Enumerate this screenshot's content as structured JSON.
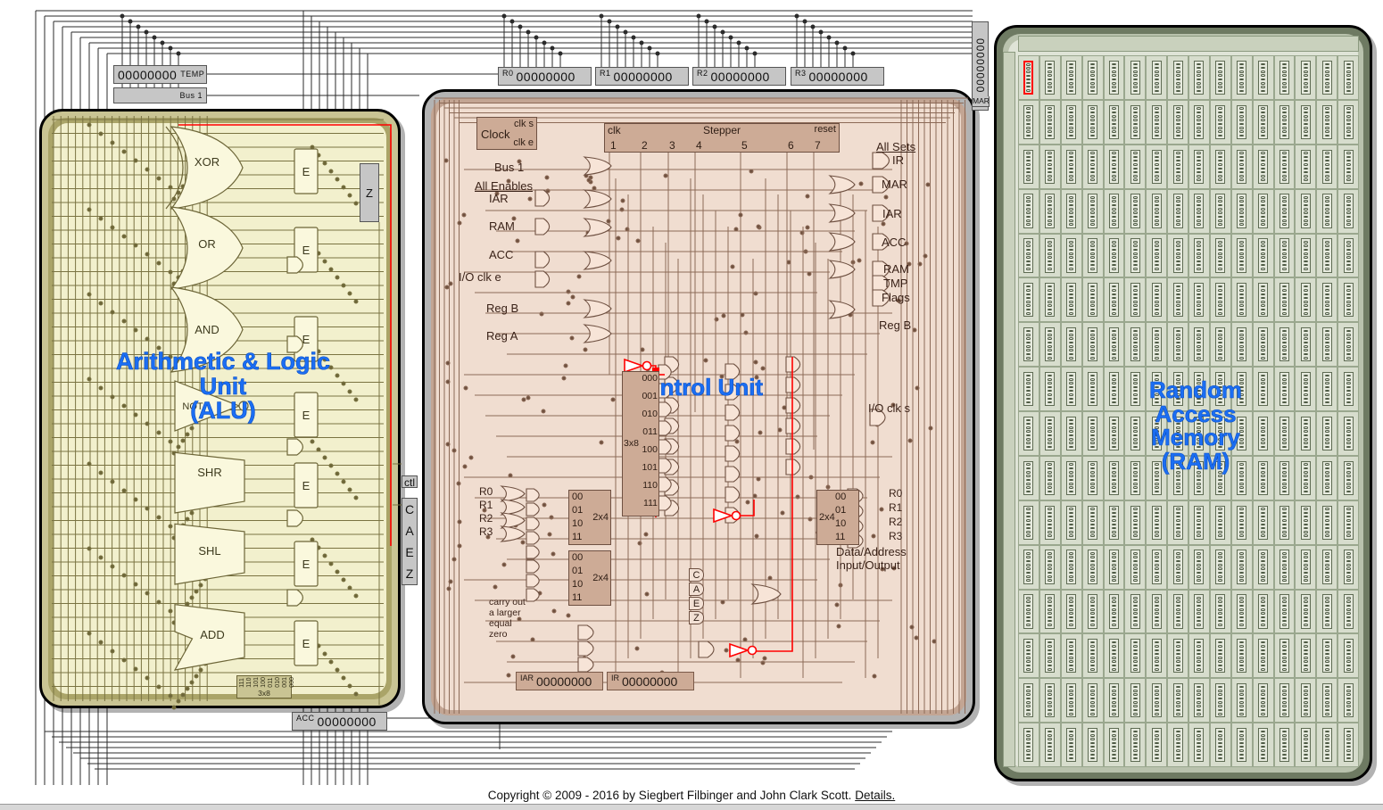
{
  "page": {
    "footer_text": "Copyright © 2009 - 2016 by Siegbert Filbinger and John Clark Scott.",
    "footer_link": "Details.",
    "zero_byte": "00000000"
  },
  "units": {
    "alu": {
      "title": "Arithmetic & Logic\nUnit\n(ALU)",
      "accent": "#1b6ef3",
      "fill": "#f2f0cd",
      "frame": "#aaa468"
    },
    "cu": {
      "title": "Control Unit",
      "accent": "#1b6ef3",
      "fill": "#f0ddd0",
      "frame": "#c3a593"
    },
    "ram": {
      "title": "Random\nAccess\nMemory\n(RAM)",
      "accent": "#1b6ef3",
      "fill": "#dfe4d7",
      "frame": "#b9c2ad"
    }
  },
  "bus_registers": [
    {
      "name": "TEMP",
      "tag": "TEMP",
      "value": "00000000",
      "tag_side": "right"
    },
    {
      "name": "BUS1",
      "tag": "Bus 1",
      "value": "",
      "tag_side": "right"
    },
    {
      "name": "R0",
      "tag": "R0",
      "value": "00000000",
      "tag_side": "left"
    },
    {
      "name": "R1",
      "tag": "R1",
      "value": "00000000",
      "tag_side": "left"
    },
    {
      "name": "R2",
      "tag": "R2",
      "value": "00000000",
      "tag_side": "left"
    },
    {
      "name": "R3",
      "tag": "R3",
      "value": "00000000",
      "tag_side": "left"
    },
    {
      "name": "ACC",
      "tag": "ACC",
      "value": "00000000",
      "tag_side": "left"
    }
  ],
  "alu": {
    "gates": [
      "XOR",
      "OR",
      "AND",
      "NOT",
      "SHR",
      "SHL",
      "ADD"
    ],
    "enable_label": "E",
    "zero_box": "Z",
    "decoder": {
      "name": "3x8",
      "lines": [
        "111",
        "110",
        "101",
        "100",
        "011",
        "010",
        "001",
        "000"
      ]
    },
    "ctl_label": "ctl",
    "flags": [
      "C",
      "A",
      "E",
      "Z"
    ]
  },
  "control_unit": {
    "clock": {
      "title": "Clock",
      "outputs": [
        "clk s",
        "clk e"
      ]
    },
    "stepper": {
      "title": "Stepper",
      "clk_label": "clk",
      "reset_label": "reset",
      "steps": [
        "1",
        "2",
        "3",
        "4",
        "5",
        "6",
        "7"
      ]
    },
    "bus1_label": "Bus 1",
    "all_enables_label": "All Enables",
    "enable_labels": [
      "IAR",
      "RAM",
      "ACC",
      "I/O clk e",
      "Reg B",
      "Reg A"
    ],
    "all_sets_label": "All Sets",
    "set_labels": [
      "IR",
      "MAR",
      "IAR",
      "ACC",
      "RAM",
      "TMP",
      "Flags"
    ],
    "reg_b_label": "Reg B",
    "io_clk_s_label": "I/O clk s",
    "decoder_3x8": {
      "name": "3x8",
      "lines": [
        "000",
        "001",
        "010",
        "011",
        "100",
        "101",
        "110",
        "111"
      ]
    },
    "decoder_2x4_a": {
      "name": "2x4",
      "lines": [
        "00",
        "01",
        "10",
        "11"
      ],
      "inputs": [
        "R0",
        "R1",
        "R2",
        "R3"
      ]
    },
    "decoder_2x4_b": {
      "name": "2x4",
      "lines": [
        "00",
        "01",
        "10",
        "11"
      ]
    },
    "decoder_2x4_out": {
      "name": "2x4",
      "lines": [
        "00",
        "01",
        "10",
        "11"
      ],
      "outputs": [
        "R0",
        "R1",
        "R2",
        "R3"
      ]
    },
    "flag_inputs": [
      "carry out",
      "a larger",
      "equal",
      "zero"
    ],
    "flag_stack": [
      "C",
      "A",
      "E",
      "Z"
    ],
    "io_label": "Data/Address\nInput/Output",
    "registers": [
      {
        "tag": "IAR",
        "value": "00000000"
      },
      {
        "tag": "IR",
        "value": "00000000"
      }
    ]
  },
  "ram": {
    "mar": {
      "tag": "MAR",
      "value": "00000000"
    },
    "grid": {
      "rows": 16,
      "cols": 16,
      "bits_per_cell": 8,
      "selected_row": 0,
      "selected_col": 0
    }
  },
  "colors": {
    "alu_fill": "#f2f0cd",
    "alu_wire": "#7a7342",
    "cu_fill": "#f0ddd0",
    "cu_wire": "#8c6a57",
    "ram_fill": "#dfe4d7",
    "bus_wire": "#2b2b2b",
    "highlight": "#ff0000",
    "title": "#1b6ef3"
  }
}
